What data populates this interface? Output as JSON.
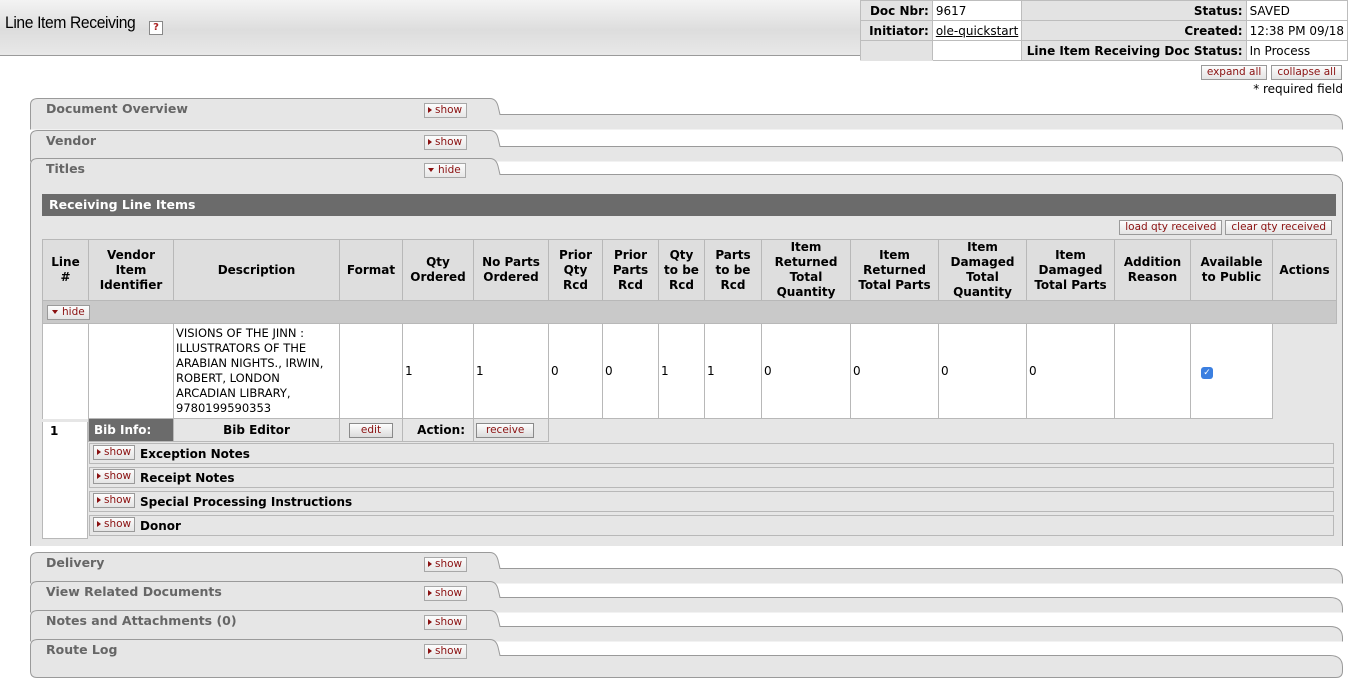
{
  "header": {
    "title": "Line Item Receiving",
    "help_glyph": "?",
    "doc_nbr_label": "Doc Nbr:",
    "doc_nbr": "9617",
    "initiator_label": "Initiator:",
    "initiator": "ole-quickstart",
    "status_label": "Status:",
    "status": "SAVED",
    "created_label": "Created:",
    "created": "12:38 PM 09/18",
    "lir_status_label": "Line Item Receiving Doc Status:",
    "lir_status": "In Process",
    "expand_all": "expand all",
    "collapse_all": "collapse all",
    "required_note": "* required field"
  },
  "tabs": {
    "document_overview": {
      "label": "Document Overview",
      "button": "show"
    },
    "vendor": {
      "label": "Vendor",
      "button": "show"
    },
    "titles": {
      "label": "Titles",
      "button": "hide"
    },
    "delivery": {
      "label": "Delivery",
      "button": "show"
    },
    "view_related": {
      "label": "View Related Documents",
      "button": "show"
    },
    "notes": {
      "label": "Notes and Attachments (0)",
      "button": "show"
    },
    "route_log": {
      "label": "Route Log",
      "button": "show"
    }
  },
  "receiving": {
    "title": "Receiving Line Items",
    "load_qty": "load qty received",
    "clear_qty": "clear qty received",
    "columns": {
      "line": "Line #",
      "vendor_item": "Vendor Item Identifier",
      "description": "Description",
      "format": "Format",
      "qty_ordered": "Qty Ordered",
      "no_parts_ordered": "No Parts Ordered",
      "prior_qty_rcd": "Prior Qty Rcd",
      "prior_parts_rcd": "Prior Parts Rcd",
      "qty_to_be_rcd": "Qty to be Rcd",
      "parts_to_be_rcd": "Parts to be Rcd",
      "item_returned_total_qty": "Item Returned Total Quantity",
      "item_returned_total_parts": "Item Returned Total Parts",
      "item_damaged_total_qty": "Item Damaged Total Quantity",
      "item_damaged_total_parts": "Item Damaged Total Parts",
      "addition_reason": "Addition Reason",
      "available_to_public": "Available to Public",
      "actions": "Actions"
    },
    "hide_button": "hide",
    "row": {
      "line": "1",
      "vendor_item": "",
      "description": "VISIONS OF THE JINN : ILLUSTRATORS OF THE ARABIAN NIGHTS., IRWIN, ROBERT, LONDON ARCADIAN LIBRARY, 9780199590353",
      "format": "",
      "qty_ordered": "1",
      "no_parts_ordered": "1",
      "prior_qty_rcd": "0",
      "prior_parts_rcd": "0",
      "qty_to_be_rcd": "1",
      "parts_to_be_rcd": "1",
      "item_returned_total_qty": "0",
      "item_returned_total_parts": "0",
      "item_damaged_total_qty": "0",
      "item_damaged_total_parts": "0",
      "addition_reason": "",
      "available_to_public": true
    },
    "bib_info_label": "Bib Info:",
    "bib_editor_label": "Bib Editor",
    "edit_button": "edit",
    "action_label": "Action:",
    "receive_button": "receive",
    "sub_sections": [
      {
        "label": "Exception Notes",
        "button": "show"
      },
      {
        "label": "Receipt Notes",
        "button": "show"
      },
      {
        "label": "Special Processing Instructions",
        "button": "show"
      },
      {
        "label": "Donor",
        "button": "show"
      }
    ]
  },
  "icons": {
    "help": "help-icon",
    "checkbox": "checkmark-icon",
    "triangle_right": "triangle-right-icon",
    "triangle_down": "triangle-down-icon"
  },
  "colors": {
    "section_header": "#6b6b6b",
    "button_text": "#8a1010",
    "checkbox": "#3b7fe0"
  }
}
